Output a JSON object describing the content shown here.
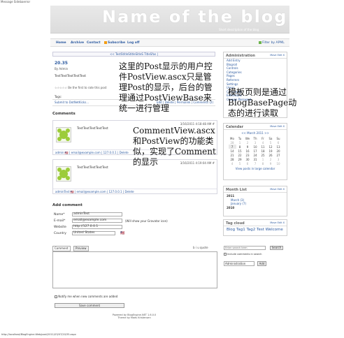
{
  "window": {
    "message": "Message Sidebaerror"
  },
  "header": {
    "title": "Name of the blog",
    "description": "Short description of the blog"
  },
  "nav": {
    "items": [
      "Home",
      "Archive",
      "Contact",
      "Subscribe",
      "Log off"
    ],
    "filter": "Filter by APML"
  },
  "pager": {
    "label": "<< TestStitleStitleSitleS TitleSfas |"
  },
  "post": {
    "title": "20.35",
    "byline": "By Admin",
    "text": "TestTextTextTestText",
    "rating": "Be the first to rate this post",
    "tags_label": "Tags:",
    "footer_left": "Submit to DotNetKicks...",
    "footer_right": "Edit | Delete | Permalink | Comments (2)"
  },
  "annotations": {
    "post_note": "这里的Post显示的用户控件PostView.ascx只是管理Post的显示，后台的管理通过PostViewBase来统一进行管理",
    "sidebar_note": "模板页则是通过BlogBasePage动态的进行读取",
    "comment_note": "CommentView.ascx和PostView的功能类似，实现了Comment的显示"
  },
  "comments": {
    "heading": "Comments",
    "items": [
      {
        "date": "3/16/2011 4:18:48 AM #",
        "text": "TestTextTestTextTest",
        "footer": "admin 🇺🇸 | email@example.com | 127.0.0.1 | Delete"
      },
      {
        "date": "3/16/2011 4:19:04 AM #",
        "text": "TestTextTestTextTest",
        "footer": "adminTest 🇺🇸 | email@example.com | 127.0.0.1 | Delete"
      }
    ]
  },
  "add_comment": {
    "heading": "Add comment",
    "name_label": "Name*",
    "name_value": "adminTest",
    "email_label": "E-mail*",
    "email_value": "email@example.com",
    "email_hint": "(Will show your Gravatar icon)",
    "website_label": "Website",
    "website_value": "http://127.0.0.1",
    "country_label": "Country",
    "country_value": "United States",
    "tab_comment": "Comment",
    "tab_preview": "Preview",
    "toolbar": "b  i  u  quote",
    "notify": "Notify me when new comments are added",
    "save": "Save comment"
  },
  "sidebar": {
    "admin": {
      "title": "Administration",
      "ctrl": "Move  Edit  X",
      "links": [
        "Add Entry",
        "Blogroll",
        "Controls",
        "Categories",
        "Pages",
        "Referrers",
        "Settings",
        "Users",
        "Comments",
        "Extensions",
        "Change Password"
      ]
    },
    "calendar": {
      "title": "Calendar",
      "ctrl": "Move  Edit  X",
      "month": "<<    March 2011    >>",
      "days": [
        "Mo",
        "Tu",
        "We",
        "Th",
        "Fr",
        "Sa",
        "Su"
      ],
      "weeks": [
        [
          "28",
          "1",
          "2",
          "3",
          "4",
          "5",
          "6"
        ],
        [
          "7",
          "8",
          "9",
          "10",
          "11",
          "12",
          "13"
        ],
        [
          "14",
          "15",
          "16",
          "17",
          "18",
          "19",
          "20"
        ],
        [
          "21",
          "22",
          "23",
          "24",
          "25",
          "26",
          "27"
        ],
        [
          "28",
          "29",
          "30",
          "31",
          "1",
          "2",
          "3"
        ],
        [
          "4",
          "5",
          "6",
          "7",
          "8",
          "9",
          "10"
        ]
      ],
      "footer": "View posts in large calendar"
    },
    "monthlist": {
      "title": "Month List",
      "ctrl": "Move  Edit  X",
      "year1": "2011",
      "m1": "March (3)",
      "m2": "January (7)",
      "year2": "2010"
    },
    "tagcloud": {
      "title": "Tag cloud",
      "ctrl": "Move  Edit  X",
      "tags": "Blog Tag1 Tag2 Test Welcome"
    },
    "search": {
      "placeholder": "Enter search term",
      "button": "Search",
      "checkbox": "Include comments in search"
    },
    "widget_select": {
      "value": "Administration",
      "button": "Add"
    }
  },
  "footer": {
    "line1": "Powered by BlogEngine.NET 1.6.0.0",
    "line2": "Theme by Mads Kristensen"
  },
  "statusbar": {
    "url": "http://localhost/BlogEngine.Web/post/2011/03/07/20/35.aspx"
  },
  "colors": {
    "link": "#2c5aa0",
    "border": "#cfcfcf"
  }
}
